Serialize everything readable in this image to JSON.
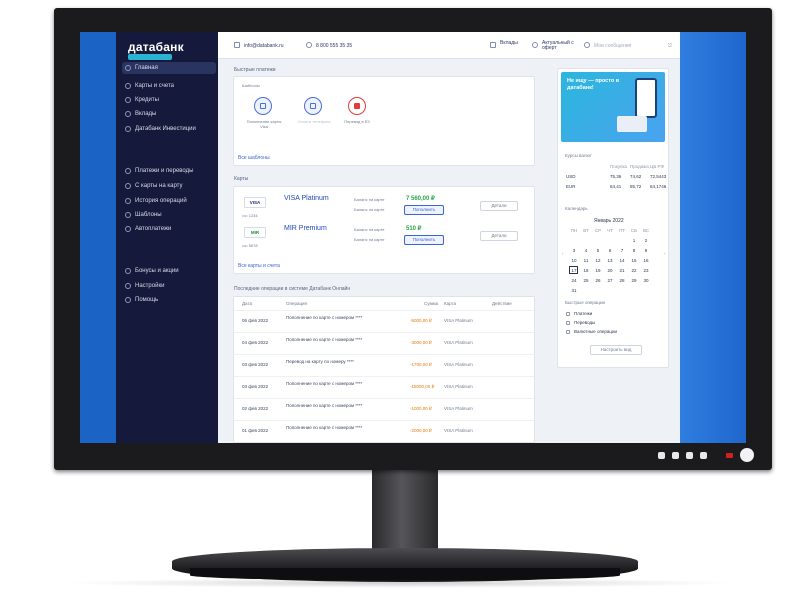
{
  "app": {
    "brand": "датабанк",
    "brand_sub": "онлайн"
  },
  "topbar": {
    "email": "info@databank.ru",
    "phone": "8 800 555 35 35",
    "messages_label": "Вклады",
    "notify_label": "Актуальный с оферт",
    "user_label": "Мои сообщения"
  },
  "sidebar": {
    "items": [
      {
        "label": "Главная",
        "active": true
      },
      {
        "label": "Карты и счета"
      },
      {
        "label": "Кредиты"
      },
      {
        "label": "Вклады"
      },
      {
        "label": "Датабанк Инвестиции"
      },
      {
        "label": "Платежи и переводы"
      },
      {
        "label": "С карты на карту"
      },
      {
        "label": "История операций"
      },
      {
        "label": "Шаблоны"
      },
      {
        "label": "Автоплатежи"
      },
      {
        "label": "Бонусы и акции"
      },
      {
        "label": "Настройки"
      },
      {
        "label": "Помощь"
      }
    ]
  },
  "quick": {
    "title": "Быстрые платежи",
    "subtitle": "Шаблоны",
    "items": [
      "Пополнение карты Visa",
      "Оплата телефона",
      "Перевод в ЕЗ"
    ],
    "all_link": "Все шаблоны"
  },
  "cards": {
    "title": "Карты",
    "rows": [
      {
        "logo": "VISA",
        "name": "VISA Platinum",
        "number": "•••• 1234",
        "note1": "Баланс на карте",
        "note2": "Баланс на карте",
        "balance": "7 560,00 ₽",
        "topup": "Пополнить",
        "details": "Детали"
      },
      {
        "logo": "MIR",
        "name": "MIR Premium",
        "number": "•••• 5678",
        "note1": "Баланс на карте",
        "note2": "Баланс на карте",
        "balance": "510 ₽",
        "topup": "Пополнить",
        "details": "Детали"
      }
    ],
    "all_link": "Все карты и счета"
  },
  "ops": {
    "title": "Последние операции в системе Датабанк Онлайн",
    "headers": [
      "Дата",
      "Операция",
      "Сумма",
      "Карта",
      "Действие"
    ],
    "rows": [
      {
        "date": "06 фев 2022",
        "desc": "Пополнение по карте с номером ****",
        "amount": "-5000,00 ₽",
        "card": "VISA Platinum"
      },
      {
        "date": "04 фев 2022",
        "desc": "Пополнение по карте с номером ****",
        "amount": "-3000,00 ₽",
        "card": "VISA Platinum"
      },
      {
        "date": "03 фев 2022",
        "desc": "Перевод на карту по номеру ****",
        "amount": "-1700,00 ₽",
        "card": "VISA Platinum"
      },
      {
        "date": "03 фев 2022",
        "desc": "Пополнение по карте с номером ****",
        "amount": "-15000,00 ₽",
        "card": "VISA Platinum"
      },
      {
        "date": "02 фев 2022",
        "desc": "Пополнение по карте с номером ****",
        "amount": "-1000,00 ₽",
        "card": "VISA Platinum"
      },
      {
        "date": "01 фев 2022",
        "desc": "Пополнение по карте с номером ****",
        "amount": "-2000,00 ₽",
        "card": "VISA Platinum"
      }
    ]
  },
  "promo": {
    "title": "Не ищу — просто в датабанк!"
  },
  "rates": {
    "title": "Курсы валют",
    "headers": [
      "Покупка",
      "Продажа",
      "ЦБ РФ"
    ],
    "rows": [
      {
        "cur": "USD",
        "buy": "75,36",
        "sell": "74,62",
        "cb": "72,5443"
      },
      {
        "cur": "EUR",
        "buy": "84,41",
        "sell": "85,72",
        "cb": "84,1746"
      }
    ]
  },
  "calendar": {
    "title": "Календарь",
    "month": "Январь 2022",
    "weekdays": [
      "ПН",
      "ВТ",
      "СР",
      "ЧТ",
      "ПТ",
      "СБ",
      "ВС"
    ],
    "days": [
      "",
      "",
      "",
      "",
      "",
      "1",
      "2",
      "3",
      "4",
      "5",
      "6",
      "7",
      "8",
      "9",
      "10",
      "11",
      "12",
      "13",
      "14",
      "15",
      "16",
      "17",
      "18",
      "19",
      "20",
      "21",
      "22",
      "23",
      "24",
      "25",
      "26",
      "27",
      "28",
      "29",
      "30",
      "31"
    ],
    "selected": "17"
  },
  "filters": {
    "title": "Быстрые операции",
    "options": [
      "Платежи",
      "Переводы",
      "Валютные операции"
    ],
    "button": "Настроить вид"
  }
}
